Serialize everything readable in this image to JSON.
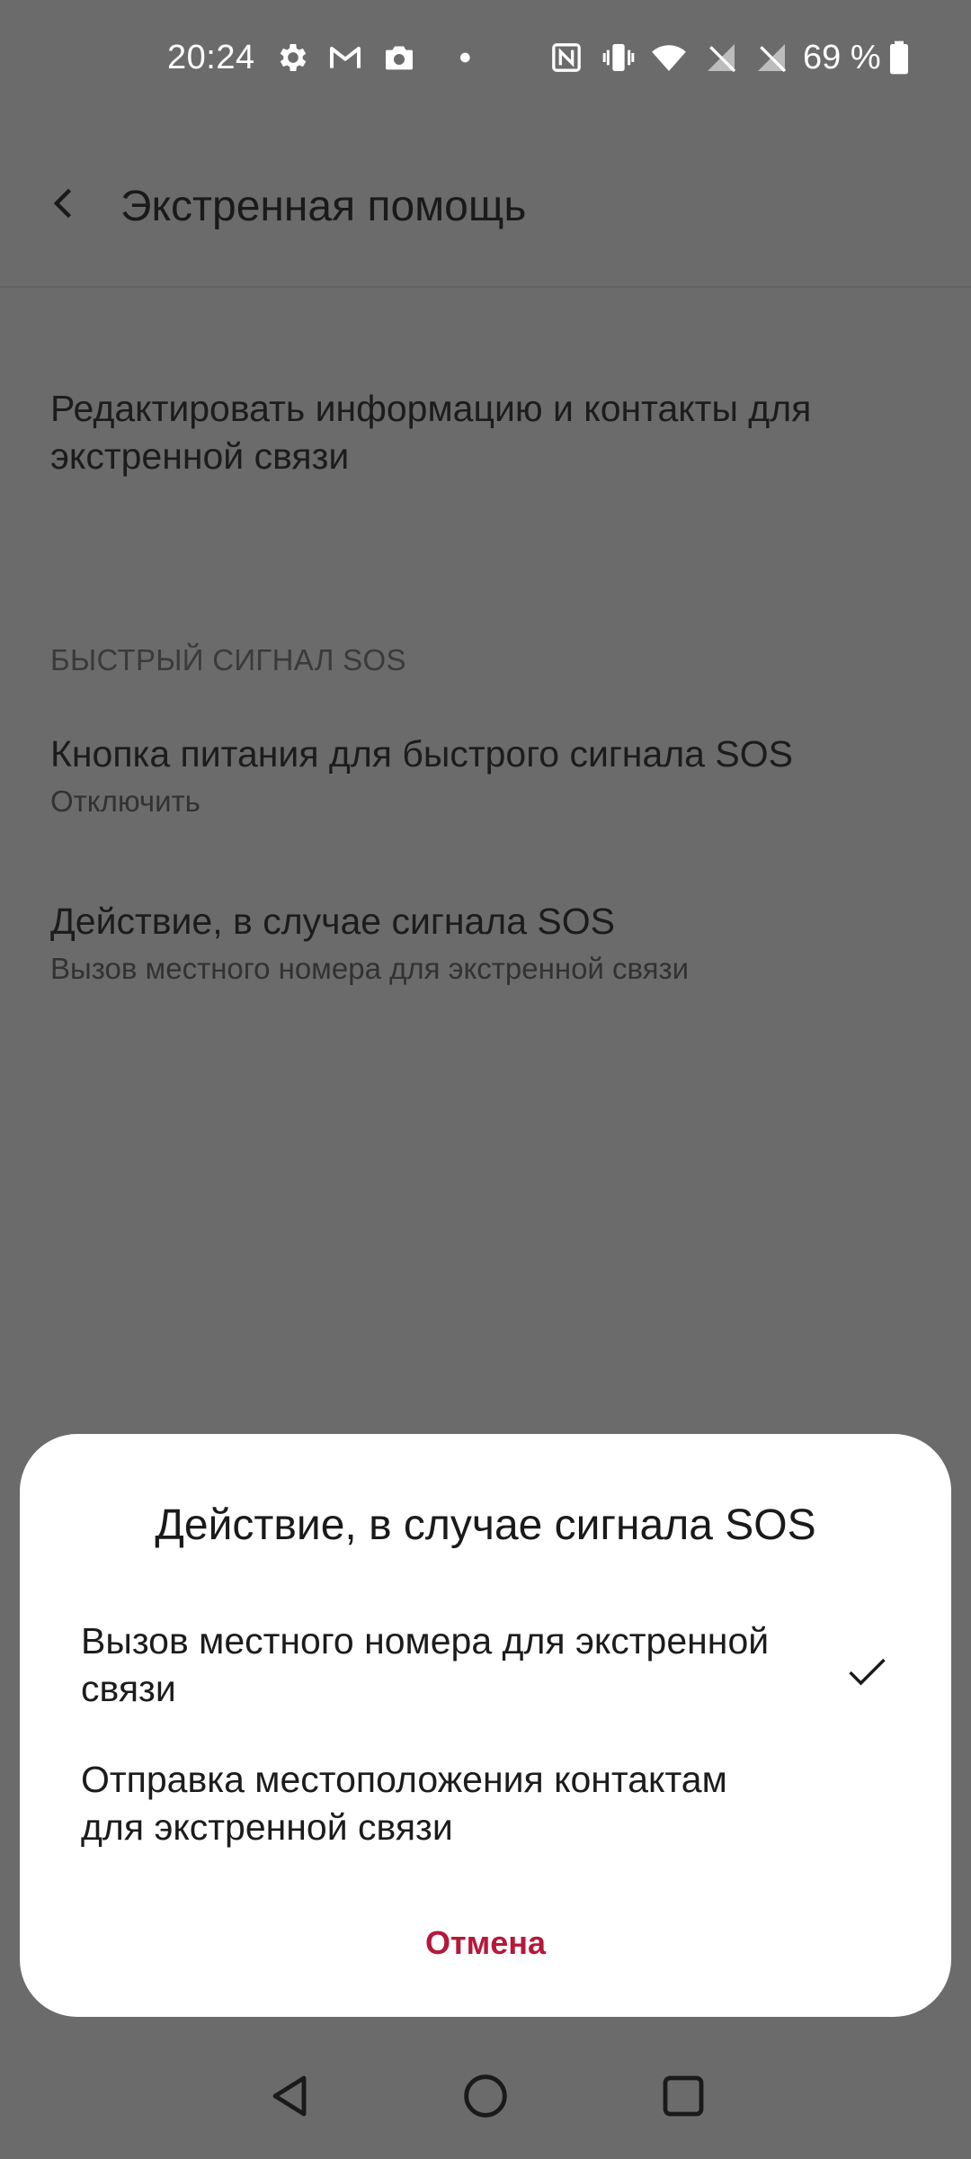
{
  "status_bar": {
    "time": "20:24",
    "battery_percent": "69 %",
    "notification_icons": [
      "gear-icon",
      "gmail-icon",
      "camera-icon",
      "dot-icon"
    ],
    "system_icons": [
      "nfc-icon",
      "vibrate-icon",
      "wifi-icon",
      "no-sim-icon",
      "no-sim-icon",
      "battery-icon"
    ]
  },
  "toolbar": {
    "title": "Экстренная помощь"
  },
  "settings": {
    "edit_info": {
      "title": "Редактировать информацию и контакты для экстренной связи"
    },
    "section_header": "БЫСТРЫЙ СИГНАЛ SOS",
    "power_button": {
      "title": "Кнопка питания для быстрого сигнала SOS",
      "summary": "Отключить"
    },
    "sos_action": {
      "title": "Действие, в случае сигнала SOS",
      "summary": "Вызов местного номера для экстренной связи"
    }
  },
  "dialog": {
    "title": "Действие, в случае сигнала SOS",
    "options": [
      {
        "label": "Вызов местного номера для экстренной связи",
        "selected": true
      },
      {
        "label": "Отправка местоположения контактам для экстренной связи",
        "selected": false
      }
    ],
    "cancel_label": "Отмена"
  },
  "colors": {
    "scrim_background": "#6b6b6b",
    "dialog_background": "#ffffff",
    "accent": "#b6183a"
  }
}
